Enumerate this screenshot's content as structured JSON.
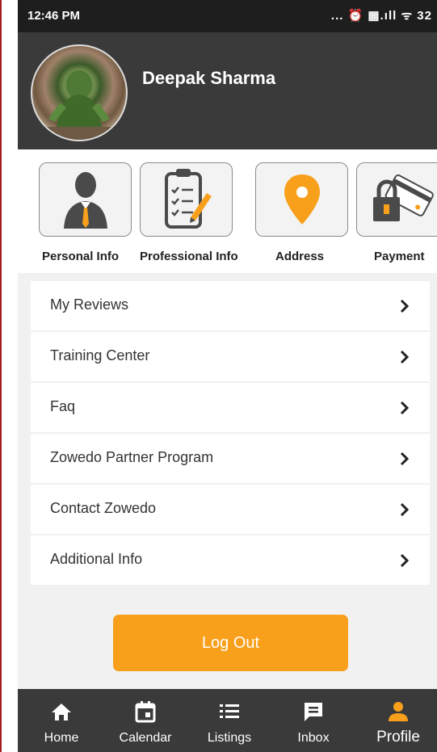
{
  "status": {
    "time": "12:46 PM",
    "icons": "... ⏰ ▦.ıll ᯤ 32"
  },
  "profile": {
    "name": "Deepak Sharma"
  },
  "categories": [
    {
      "label": "Personal Info",
      "icon": "person-suit-icon"
    },
    {
      "label": "Professional Info",
      "icon": "clipboard-checklist-icon"
    },
    {
      "label": "Address",
      "icon": "location-pin-icon"
    },
    {
      "label": "Payment",
      "icon": "card-lock-icon"
    }
  ],
  "menu": [
    {
      "label": "My Reviews"
    },
    {
      "label": "Training Center"
    },
    {
      "label": "Faq"
    },
    {
      "label": "Zowedo Partner Program"
    },
    {
      "label": "Contact Zowedo"
    },
    {
      "label": "Additional Info"
    }
  ],
  "logout": {
    "label": "Log Out"
  },
  "nav": [
    {
      "label": "Home",
      "icon": "home-icon"
    },
    {
      "label": "Calendar",
      "icon": "calendar-icon"
    },
    {
      "label": "Listings",
      "icon": "list-icon"
    },
    {
      "label": "Inbox",
      "icon": "message-icon"
    },
    {
      "label": "Profile",
      "icon": "person-icon",
      "active": true
    }
  ],
  "colors": {
    "accent": "#f8a01c",
    "header_bg": "#3a3a3a",
    "statusbar_bg": "#1e1e1e"
  }
}
